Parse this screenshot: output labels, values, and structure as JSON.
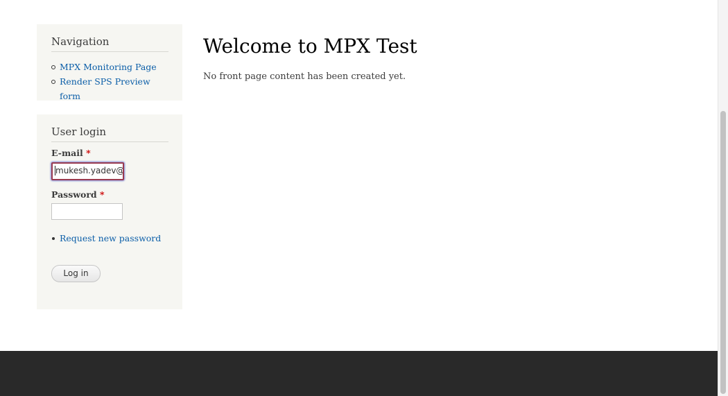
{
  "navigation": {
    "title": "Navigation",
    "items": [
      {
        "label": "MPX Monitoring Page"
      },
      {
        "label": "Render SPS Preview form"
      }
    ]
  },
  "user_login": {
    "title": "User login",
    "email_label": "E-mail",
    "email_value": "mukesh.yadev@",
    "password_label": "Password",
    "required_marker": "*",
    "request_password_label": "Request new password",
    "login_button_label": "Log in"
  },
  "main": {
    "title": "Welcome to MPX Test",
    "message": "No front page content has been created yet."
  },
  "colors": {
    "link": "#0b5ea8",
    "footer": "#292929",
    "sidebar_background": "#f6f6f2",
    "required": "#cc0000"
  }
}
